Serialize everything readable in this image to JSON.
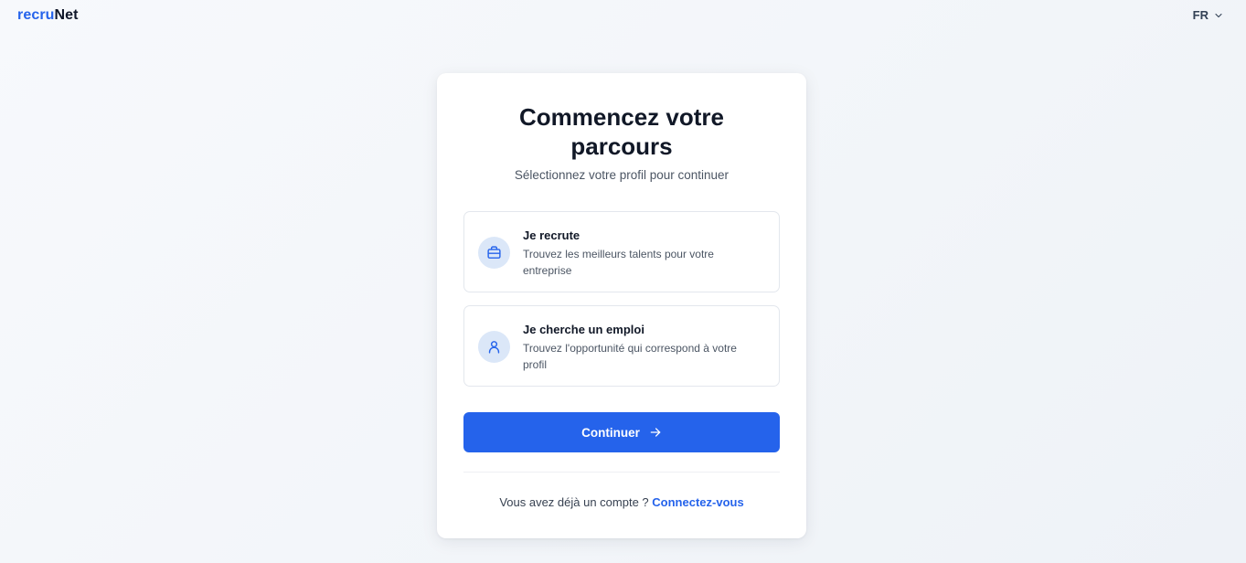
{
  "header": {
    "logo_part1": "recru",
    "logo_part2": "Net",
    "language": "FR"
  },
  "card": {
    "title_line1": "Commencez votre",
    "title_line2": "parcours",
    "subtitle": "Sélectionnez votre profil pour continuer",
    "options": [
      {
        "icon": "briefcase-icon",
        "title": "Je recrute",
        "description": "Trouvez les meilleurs talents pour votre entreprise"
      },
      {
        "icon": "user-icon",
        "title": "Je cherche un emploi",
        "description": "Trouvez l'opportunité qui correspond à votre profil"
      }
    ],
    "continue_label": "Continuer",
    "footer_text": "Vous avez déjà un compte ?",
    "login_link": "Connectez-vous"
  },
  "colors": {
    "accent": "#2563eb",
    "icon_bg": "#dbe7f8",
    "text_dark": "#111827",
    "text_muted": "#4b5563"
  }
}
